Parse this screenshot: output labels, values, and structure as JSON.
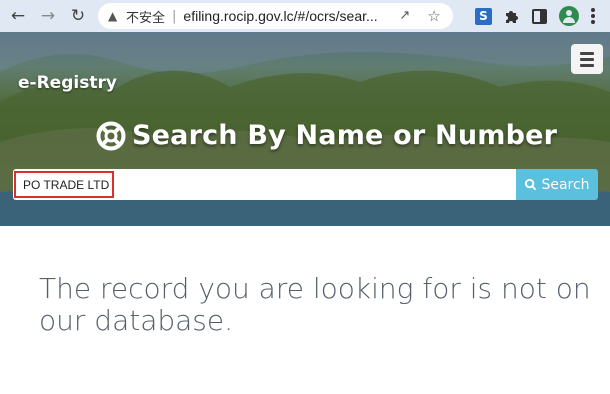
{
  "browser": {
    "insecure_label": "不安全",
    "separator": "|",
    "url": "efiling.rocip.gov.lc/#/ocrs/sear...",
    "extension_letter": "S"
  },
  "header": {
    "brand": "e-Registry"
  },
  "hero": {
    "heading": "Search By Name or Number"
  },
  "search": {
    "value": "PO TRADE LTD",
    "button_label": "Search"
  },
  "result": {
    "message": "The record you are looking for is not on our database."
  },
  "colors": {
    "search_button": "#5bc0de",
    "highlight_border": "#d9302d",
    "message_text": "#555f6b"
  }
}
